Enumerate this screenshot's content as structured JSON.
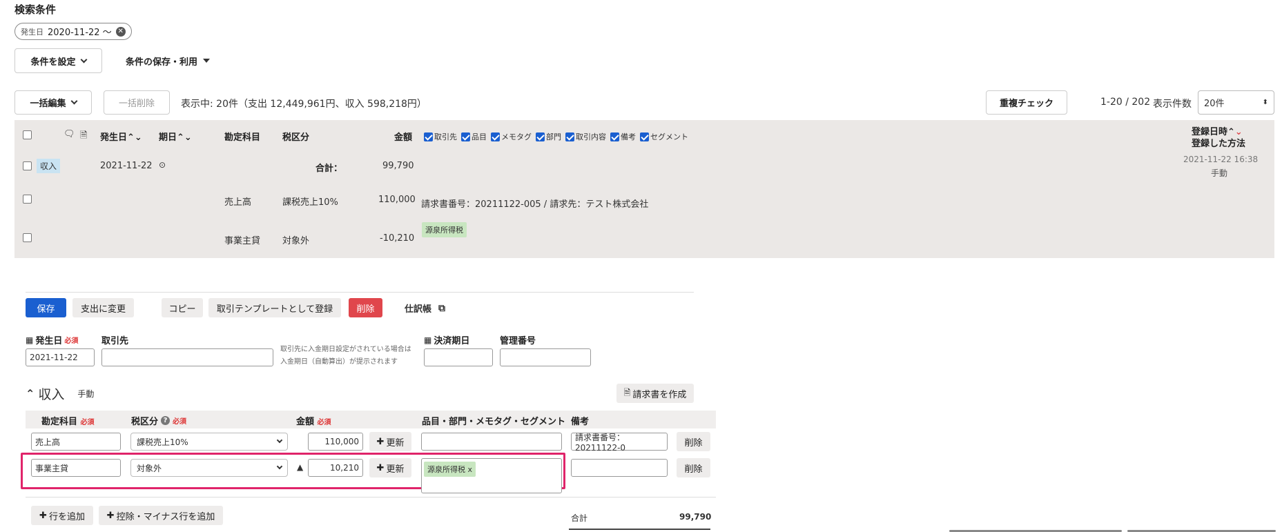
{
  "search": {
    "title": "検索条件",
    "chip_label": "発生日",
    "chip_value": "2020-11-22 〜",
    "set_conditions": "条件を設定",
    "save_use": "条件の保存・利用"
  },
  "toolbar": {
    "bulk_edit": "一括編集",
    "bulk_delete": "一括削除",
    "summary": "表示中: 20件（支出 12,449,961円、収入 598,218円）",
    "dup_check": "重複チェック",
    "paging": "1-20 / 202",
    "per_page_label": "表示件数",
    "per_page_value": "20件"
  },
  "list_header": {
    "date": "発生日",
    "due": "期日",
    "account": "勘定科目",
    "tax": "税区分",
    "amount": "金額",
    "columns": [
      "取引先",
      "品目",
      "メモタグ",
      "部門",
      "取引内容",
      "備考",
      "セグメント"
    ],
    "reg_time": "登録日時",
    "reg_method": "登録した方法"
  },
  "list_rows": {
    "type_badge": "収入",
    "date": "2021-11-22",
    "total_label": "合計：",
    "total_value": "99,790",
    "reg_time": "2021-11-22 16:38",
    "reg_method": "手動",
    "line1_account": "売上高",
    "line1_tax": "課税売上10%",
    "line1_amount": "110,000",
    "line1_memo": "請求書番号：20211122-005 / 請求先：テスト株式会社",
    "line2_account": "事業主貸",
    "line2_tax": "対象外",
    "line2_amount": "-10,210",
    "line2_tag": "源泉所得税"
  },
  "detail": {
    "save": "保存",
    "to_expense": "支出に変更",
    "copy": "コピー",
    "register_template": "取引テンプレートとして登録",
    "delete": "削除",
    "journal": "仕訳帳",
    "date_label": "発生日",
    "required": "必須",
    "date_value": "2021-11-22",
    "partner_label": "取引先",
    "partner_note_1": "取引先に入金期日設定がされている場合は",
    "partner_note_2": "入金期日（自動算出）が提示されます",
    "settle_label": "決済期日",
    "mgmt_label": "管理番号",
    "section_title": "収入",
    "section_method": "手動",
    "create_invoice": "請求書を作成",
    "col_account": "勘定科目",
    "col_tax": "税区分",
    "col_amount": "金額",
    "col_items": "品目・部門・メモタグ・セグメント",
    "col_memo": "備考",
    "row1_account": "売上高",
    "row1_tax": "課税売上10%",
    "row1_amount": "110,000",
    "row1_memo": "請求書番号：20211122-0",
    "row2_account": "事業主貸",
    "row2_tax": "対象外",
    "row2_sign": "▲",
    "row2_amount": "10,210",
    "row2_tag": "源泉所得税 x",
    "update": "更新",
    "row_delete": "削除",
    "add_row": "行を追加",
    "add_deduct_row": "控除・マイナス行を追加",
    "total_label": "合計",
    "total_value": "99,790"
  },
  "colors": {
    "primary": "#1a5fd0",
    "danger": "#e0464c",
    "highlight": "#e0246a",
    "tag": "#c8e6c0",
    "row_bg": "#ebe8e6"
  }
}
